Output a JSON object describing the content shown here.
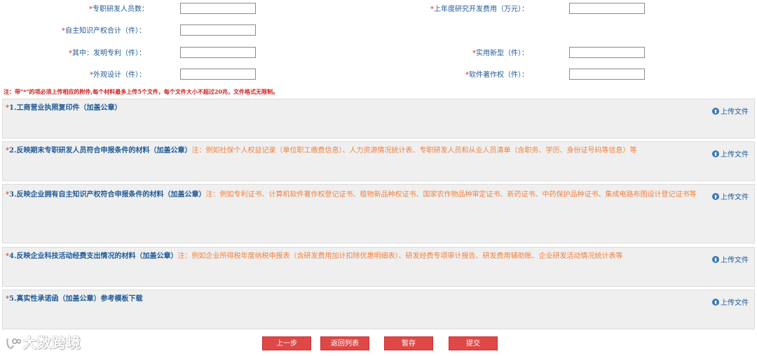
{
  "colors": {
    "label": "#1f5a99",
    "required": "#e03030",
    "hint": "#f08040",
    "note": "#d42020",
    "button": "#e04848",
    "panel": "#efefef"
  },
  "required_mark": "*",
  "fields": {
    "rd_staff": {
      "label": "专职研发人员数：",
      "value": ""
    },
    "rd_expense": {
      "label": "上年度研究开发费用（万元）：",
      "value": ""
    },
    "ip_total": {
      "label": "自主知识产权合计（件）：",
      "value": ""
    },
    "invention_patent": {
      "label": "其中：发明专利（件）：",
      "value": ""
    },
    "utility_model": {
      "label": "实用新型（件）：",
      "value": ""
    },
    "design": {
      "label": "外观设计（件）：",
      "value": ""
    },
    "software_copyright": {
      "label": "软件著作权（件）：",
      "value": ""
    }
  },
  "note": "注：带\"*\"的项必须上传相应的附件,每个材料最多上传5个文件，每个文件大小不超过20兆，文件格式无限制。",
  "upload_label": "上传文件",
  "upload_icon": "upload-circle-icon",
  "attachments": [
    {
      "title": "1.工商营业执照复印件（加盖公章）",
      "hint": ""
    },
    {
      "title": "2.反映期末专职研发人员符合申报条件的材料（加盖公章）",
      "hint": "注：例如社保个人权益记录（单位职工缴费信息）、人力资源情况统计表、专职研发人员和从业人员清单（含职务、学历、身份证号码等信息）等"
    },
    {
      "title": "3.反映企业拥有自主知识产权符合申报条件的材料（加盖公章）",
      "hint": "注：例如专利证书、计算机软件著作权登记证书、植物新品种权证书、国家农作物品种审定证书、新药证书、中药保护品种证书、集成电路布图设计登记证书等"
    },
    {
      "title": "4.反映企业科技活动经费支出情况的材料（加盖公章）",
      "hint": "注：例如企业所得税年度纳税申报表（含研发费用加计扣除优惠明细表）、研发经费专项审计报告、研发费用辅助账、企业研发活动情况统计表等"
    },
    {
      "title": "5.真实性承诺函（加盖公章）参考模板下载",
      "hint": ""
    }
  ],
  "buttons": {
    "prev": "上一步",
    "back_list": "返回列表",
    "save": "暂存",
    "submit": "提交"
  },
  "watermark": "大数跨境"
}
